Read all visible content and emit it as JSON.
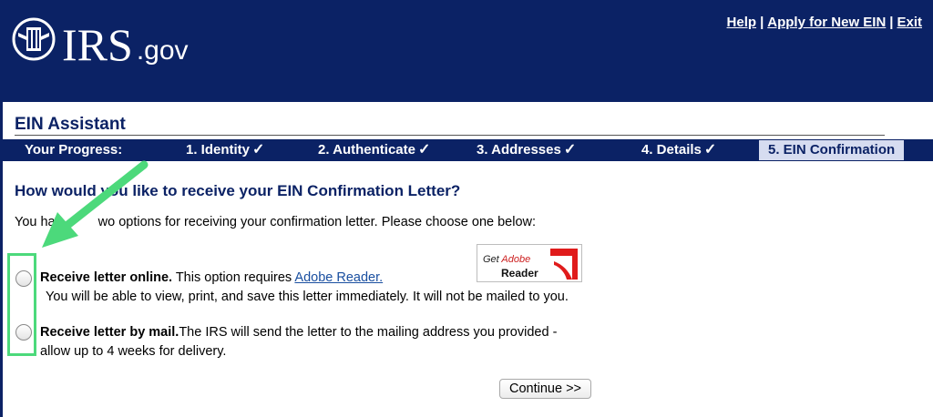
{
  "header": {
    "logo_text": "IRS",
    "logo_suffix": ".gov",
    "links": {
      "help": "Help",
      "apply": "Apply for New EIN",
      "exit": "Exit",
      "separator": "|"
    }
  },
  "assistant": {
    "title": "EIN Assistant"
  },
  "progress": {
    "label": "Your Progress:",
    "steps": [
      {
        "label": "1. Identity",
        "check": "✓"
      },
      {
        "label": "2. Authenticate",
        "check": "✓"
      },
      {
        "label": "3. Addresses",
        "check": "✓"
      },
      {
        "label": "4. Details",
        "check": "✓"
      },
      {
        "label": "5. EIN Confirmation",
        "check": ""
      }
    ],
    "current_step": 5
  },
  "question": "How would you like to receive your EIN Confirmation Letter?",
  "intro_visible": {
    "start": "You ha",
    "end": "wo options for receiving your confirmation letter. Please choose one below:"
  },
  "options": [
    {
      "title": "Receive letter online.",
      "text": " This option requires ",
      "link": "Adobe Reader.",
      "line2": "You will be able to view, print, and save this letter immediately. It will not be mailed to you.",
      "selected": false
    },
    {
      "title": "Receive letter by mail.",
      "text": "The IRS will send the letter to the mailing address you provided -",
      "line2": "allow up to 4 weeks for delivery.",
      "selected": false
    }
  ],
  "adobe_badge": {
    "get": "Get ",
    "adobe": "Adobe",
    "reader": "Reader"
  },
  "buttons": {
    "continue": "Continue >>"
  },
  "colors": {
    "irs_navy": "#0b2265",
    "highlight_green": "#4cd97b",
    "link_blue": "#1a4fa0"
  },
  "icons": {
    "logo": "irs-eagle-icon",
    "annotation": "green-arrow-icon"
  }
}
